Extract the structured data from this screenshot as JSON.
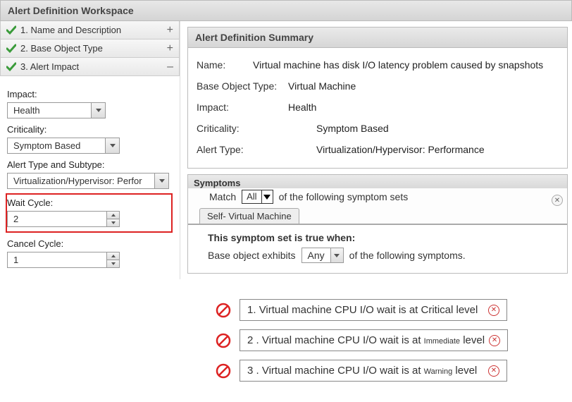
{
  "workspace_title": "Alert Definition Workspace",
  "accordion": {
    "item1": {
      "label": "1. Name and Description",
      "expander": "+"
    },
    "item2": {
      "label": "2. Base Object Type",
      "expander": "+"
    },
    "item3": {
      "label": "3. Alert Impact",
      "expander": "–"
    }
  },
  "impact_form": {
    "impact_label": "Impact:",
    "impact_value": "Health",
    "criticality_label": "Criticality:",
    "criticality_value": "Symptom Based",
    "alert_type_label": "Alert Type and Subtype:",
    "alert_type_value": "Virtualization/Hypervisor: Perfor",
    "wait_cycle_label": "Wait Cycle:",
    "wait_cycle_value": "2",
    "cancel_cycle_label": "Cancel Cycle:",
    "cancel_cycle_value": "1"
  },
  "summary": {
    "header": "Alert Definition Summary",
    "name_label": "Name:",
    "name_value": "Virtual machine has disk I/O latency problem caused by snapshots",
    "base_object_label": "Base Object Type:",
    "base_object_value": "Virtual Machine",
    "impact_label": "Impact:",
    "impact_value": "Health",
    "criticality_label": "Criticality:",
    "criticality_value": "Symptom Based",
    "alert_type_label": "Alert Type:",
    "alert_type_value": "Virtualization/Hypervisor: Performance"
  },
  "symptoms": {
    "header": "Symptoms",
    "match_prefix": "Match",
    "match_value": "All",
    "match_suffix": "of the following symptom sets",
    "tab_label": "Self- Virtual Machine",
    "set_title": "This symptom set is true when:",
    "base_prefix": "Base object exhibits",
    "base_value": "Any",
    "base_suffix": "of the following symptoms.",
    "items": [
      {
        "num": "1.",
        "text_a": "Virtual machine CPU I/O wait is at Critical level"
      },
      {
        "num": "2 .",
        "text_a": "Virtual machine CPU I/O wait is at",
        "badge": "Immediate",
        "text_b": "level"
      },
      {
        "num": "3 .",
        "text_a": "Virtual machine CPU I/O wait is at",
        "badge": "Warning",
        "text_b": "level"
      }
    ]
  }
}
